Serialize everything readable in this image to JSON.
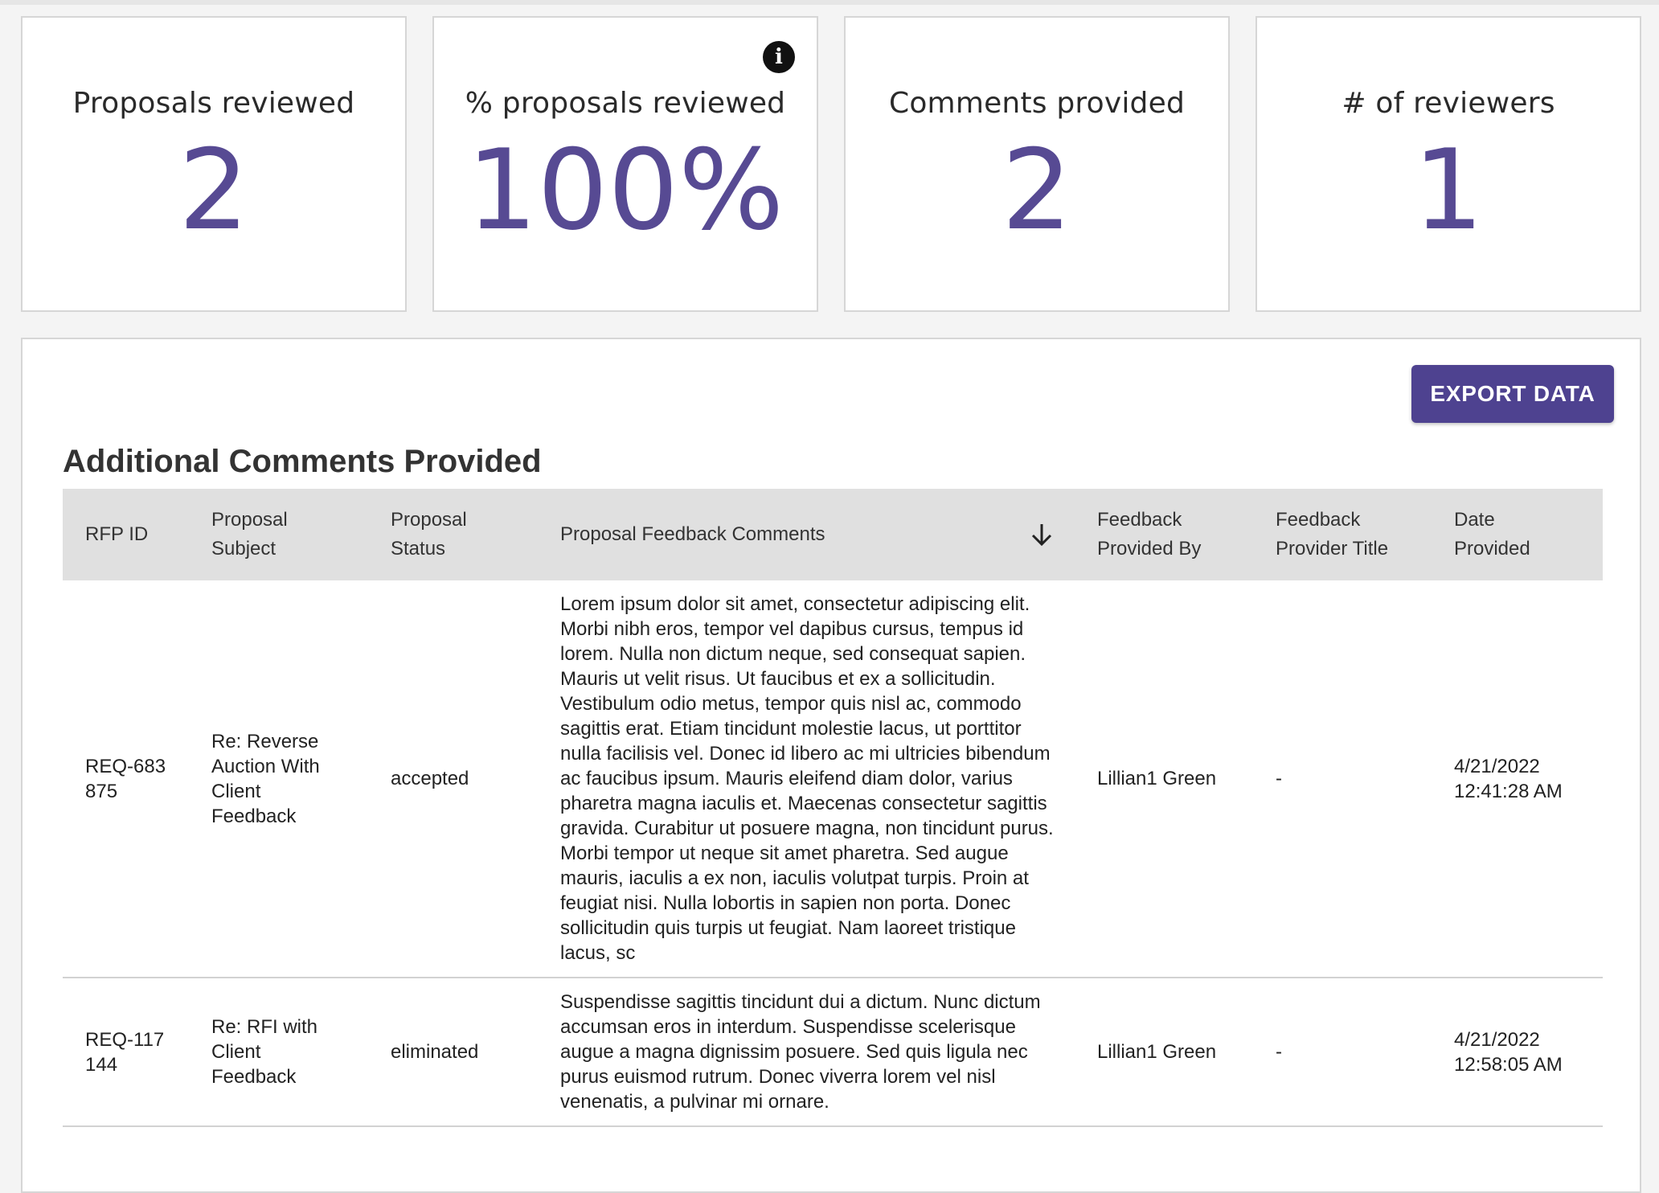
{
  "stats": [
    {
      "label": "Proposals reviewed",
      "value": "2",
      "info": false
    },
    {
      "label": "% proposals reviewed",
      "value": "100%",
      "info": true
    },
    {
      "label": "Comments provided",
      "value": "2",
      "info": false
    },
    {
      "label": "# of reviewers",
      "value": "1",
      "info": false
    }
  ],
  "info_icon": "info-icon",
  "colors": {
    "accent": "#574a93",
    "button": "#4e4290",
    "header_bg": "#e0e0e0"
  },
  "panel": {
    "export_label": "EXPORT DATA",
    "title": "Additional Comments Provided"
  },
  "table": {
    "columns": [
      "RFP ID",
      "Proposal Subject",
      "Proposal Status",
      "Proposal Feedback Comments",
      "Feedback Provided By",
      "Feedback Provider Title",
      "Date Provided"
    ],
    "sort_icon": "arrow-down-icon",
    "rows": [
      {
        "rfp_id": "REQ-683875",
        "subject": "Re: Reverse Auction With Client Feedback",
        "status": "accepted",
        "comment": "Lorem ipsum dolor sit amet, consectetur adipiscing elit. Morbi nibh eros, tempor vel dapibus cursus, tempus id lorem. Nulla non dictum neque, sed consequat sapien. Mauris ut velit risus. Ut faucibus et ex a sollicitudin. Vestibulum odio metus, tempor quis nisl ac, commodo sagittis erat. Etiam tincidunt molestie lacus, ut porttitor nulla facilisis vel. Donec id libero ac mi ultricies bibendum ac faucibus ipsum. Mauris eleifend diam dolor, varius pharetra magna iaculis et. Maecenas consectetur sagittis gravida. Curabitur ut posuere magna, non tincidunt purus. Morbi tempor ut neque sit amet pharetra. Sed augue mauris, iaculis a ex non, iaculis volutpat turpis. Proin at feugiat nisi. Nulla lobortis in sapien non porta. Donec sollicitudin quis turpis ut feugiat. Nam laoreet tristique lacus, sc",
        "provided_by": "Lillian1 Green",
        "provider_title": "-",
        "date": "4/21/2022 12:41:28 AM"
      },
      {
        "rfp_id": "REQ-117144",
        "subject": "Re: RFI with Client Feedback",
        "status": "eliminated",
        "comment": "Suspendisse sagittis tincidunt dui a dictum. Nunc dictum accumsan eros in interdum. Suspendisse scelerisque augue a magna dignissim posuere. Sed quis ligula nec purus euismod rutrum. Donec viverra lorem vel nisl venenatis, a pulvinar mi ornare.",
        "provided_by": "Lillian1 Green",
        "provider_title": "-",
        "date": "4/21/2022 12:58:05 AM"
      }
    ]
  }
}
